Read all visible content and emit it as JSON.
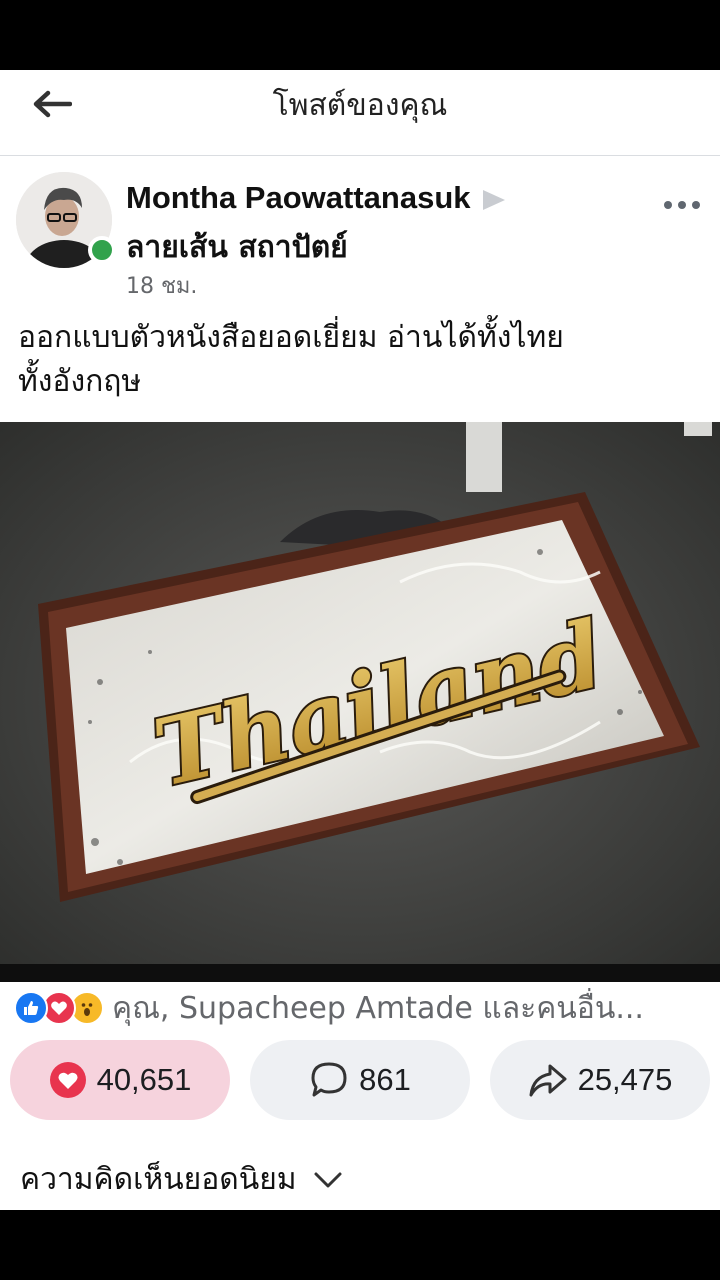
{
  "header": {
    "title": "โพสต์ของคุณ"
  },
  "post": {
    "author": "Montha Paowattanasuk",
    "page": "ลายเส้น สถาปัตย์",
    "time": "18 ชม.",
    "caption_line1": "ออกแบบตัวหนังสือยอดเยี่ยม อ่านได้ทั้งไทย",
    "caption_line2": "ทั้งอังกฤษ",
    "sign_text": "Thailand"
  },
  "reactions": {
    "icons": [
      "like-icon",
      "love-icon",
      "wow-icon"
    ],
    "summary": "คุณ, Supacheep Amtade และคนอื่น..."
  },
  "actions": {
    "likes": "40,651",
    "comments": "861",
    "shares": "25,475"
  },
  "comments": {
    "filter_label": "ความคิดเห็นยอดนิยม"
  },
  "colors": {
    "online": "#31a24c",
    "like_blue": "#1877f2",
    "love_red": "#e8344e",
    "wow_yellow": "#f7b928",
    "liked_pill": "#f6d3dd"
  }
}
